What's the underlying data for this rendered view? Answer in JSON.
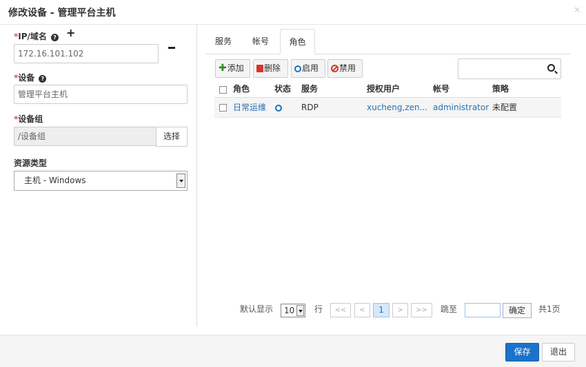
{
  "dialog": {
    "title": "修改设备 - 管理平台主机",
    "close_label": "×"
  },
  "form": {
    "ip": {
      "label": "IP/域名",
      "required_mark": "*",
      "value": "172.16.101.102"
    },
    "device": {
      "label": "设备",
      "required_mark": "*",
      "value": "管理平台主机"
    },
    "group": {
      "label": "设备组",
      "required_mark": "*",
      "value": "/设备组",
      "select_label": "选择"
    },
    "resource_type": {
      "label": "资源类型",
      "selected": "主机 - Windows"
    }
  },
  "tabs": [
    {
      "label": "服务",
      "active": false
    },
    {
      "label": "帐号",
      "active": false
    },
    {
      "label": "角色",
      "active": true
    }
  ],
  "toolbar": {
    "add": "添加",
    "delete": "删除",
    "enable": "启用",
    "disable": "禁用"
  },
  "table": {
    "headers": [
      "角色",
      "状态",
      "服务",
      "授权用户",
      "帐号",
      "策略"
    ],
    "rows": [
      {
        "role": "日常运维",
        "status": "enabled",
        "service": "RDP",
        "users": "xucheng,zen...",
        "account": "administrator",
        "policy": "未配置"
      }
    ]
  },
  "pager": {
    "show_label": "默认显示",
    "page_size": "10",
    "rows_label": "行",
    "first": "<<",
    "prev": "<",
    "current": "1",
    "next": ">",
    "last": ">>",
    "jump_label": "跳至",
    "confirm": "确定",
    "total": "共1页"
  },
  "footer": {
    "save": "保存",
    "exit": "退出"
  },
  "colors": {
    "primary": "#1a73c9",
    "link": "#2a6fb0",
    "required": "#d9534f",
    "add_icon": "#2e8b1e",
    "danger_icon": "#d9342b"
  }
}
